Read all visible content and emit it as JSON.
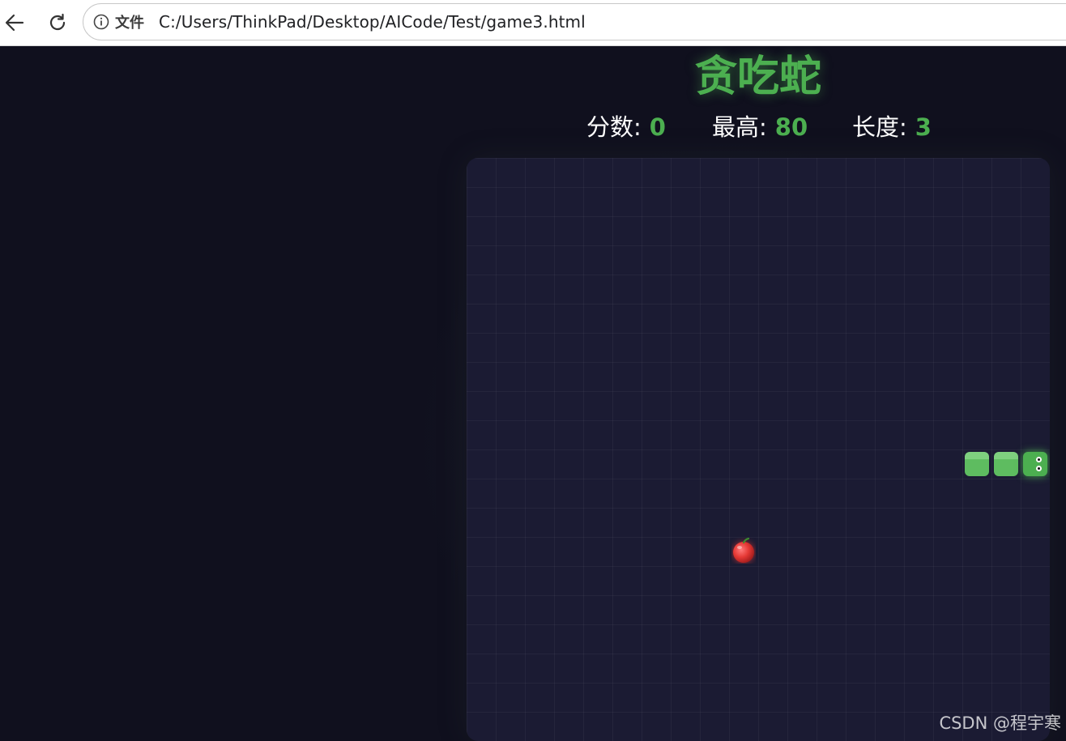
{
  "browser": {
    "file_label": "文件",
    "url": "C:/Users/ThinkPad/Desktop/AICode/Test/game3.html",
    "icons": [
      "back-arrow-icon",
      "reload-icon",
      "info-icon"
    ]
  },
  "game": {
    "title": "贪吃蛇",
    "stats": {
      "score_label": "分数:",
      "score_value": "0",
      "best_label": "最高:",
      "best_value": "80",
      "length_label": "长度:",
      "length_value": "3"
    },
    "grid": {
      "columns": 20,
      "rows": 20
    },
    "snake": [
      {
        "col": 17,
        "row": 10,
        "part": "body"
      },
      {
        "col": 18,
        "row": 10,
        "part": "body"
      },
      {
        "col": 19,
        "row": 10,
        "part": "head"
      }
    ],
    "direction": "right",
    "food": {
      "col": 9,
      "row": 13,
      "icon": "apple-icon"
    },
    "colors": {
      "accent": "#4caf50",
      "background": "#10101e",
      "board": "#1b1b33",
      "food": "#e53935"
    }
  },
  "watermark": "CSDN @程宇寒"
}
